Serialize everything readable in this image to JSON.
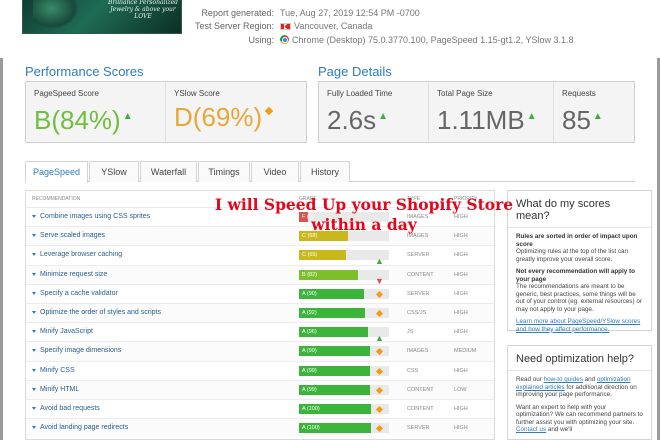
{
  "report": {
    "thumbnail_text": "Brilliance Personalized Jewelry & above your LOVE",
    "generated_label": "Report generated:",
    "generated_value": "Tue, Aug 27, 2019 12:54 PM -0700",
    "region_label": "Test Server Region:",
    "region_value": "Vancouver, Canada",
    "using_label": "Using:",
    "using_value": "Chrome (Desktop) 75.0.3770.100, PageSpeed 1.15-gt1.2, YSlow 3.1.8"
  },
  "performance": {
    "title": "Performance Scores",
    "pagespeed": {
      "label": "PageSpeed Score",
      "grade": "B",
      "value": "(84%)"
    },
    "yslow": {
      "label": "YSlow Score",
      "grade": "D",
      "value": "(69%)"
    }
  },
  "page_details": {
    "title": "Page Details",
    "load_time": {
      "label": "Fully Loaded Time",
      "value": "2.6s"
    },
    "page_size": {
      "label": "Total Page Size",
      "value": "1.11MB"
    },
    "requests": {
      "label": "Requests",
      "value": "85"
    }
  },
  "tabs": [
    "PageSpeed",
    "YSlow",
    "Waterfall",
    "Timings",
    "Video",
    "History"
  ],
  "table": {
    "headers": {
      "recommendation": "RECOMMENDATION",
      "grade": "GRADE",
      "type": "TYPE",
      "priority": "PRIORITY"
    },
    "rows": [
      {
        "name": "Combine images using CSS sprites",
        "grade": "F (0)",
        "score": 0,
        "trend": "",
        "type": "IMAGES",
        "priority": "HIGH",
        "band": "f"
      },
      {
        "name": "Serve scaled images",
        "grade": "C (68)",
        "score": 68,
        "trend": "",
        "type": "IMAGES",
        "priority": "HIGH",
        "band": "c"
      },
      {
        "name": "Leverage browser caching",
        "grade": "C (65)",
        "score": 65,
        "trend": "up",
        "type": "SERVER",
        "priority": "HIGH",
        "band": "c"
      },
      {
        "name": "Minimize request size",
        "grade": "B (82)",
        "score": 82,
        "trend": "down",
        "type": "CONTENT",
        "priority": "HIGH",
        "band": "b"
      },
      {
        "name": "Specify a cache validator",
        "grade": "A (90)",
        "score": 90,
        "trend": "neutral",
        "type": "SERVER",
        "priority": "HIGH",
        "band": "a"
      },
      {
        "name": "Optimize the order of styles and scripts",
        "grade": "A (92)",
        "score": 92,
        "trend": "neutral",
        "type": "CSS/JS",
        "priority": "HIGH",
        "band": "a"
      },
      {
        "name": "Minify JavaScript",
        "grade": "A (96)",
        "score": 96,
        "trend": "up",
        "type": "JS",
        "priority": "HIGH",
        "band": "a"
      },
      {
        "name": "Specify image dimensions",
        "grade": "A (99)",
        "score": 99,
        "trend": "neutral",
        "type": "IMAGES",
        "priority": "MEDIUM",
        "band": "a"
      },
      {
        "name": "Minify CSS",
        "grade": "A (99)",
        "score": 99,
        "trend": "neutral",
        "type": "CSS",
        "priority": "HIGH",
        "band": "a"
      },
      {
        "name": "Minify HTML",
        "grade": "A (99)",
        "score": 99,
        "trend": "neutral",
        "type": "CONTENT",
        "priority": "LOW",
        "band": "a"
      },
      {
        "name": "Avoid bad requests",
        "grade": "A (100)",
        "score": 100,
        "trend": "neutral",
        "type": "CONTENT",
        "priority": "HIGH",
        "band": "a"
      },
      {
        "name": "Avoid landing page redirects",
        "grade": "A (100)",
        "score": 100,
        "trend": "neutral",
        "type": "SERVER",
        "priority": "HIGH",
        "band": "a"
      }
    ]
  },
  "side_scores": {
    "title": "What do my scores mean?",
    "p1_bold": "Rules are sorted in order of impact upon score",
    "p1": "Optimizing rules at the top of the list can greatly improve your overall score.",
    "p2_bold": "Not every recommendation will apply to your page",
    "p2": "The recommendations are meant to be generic, best practices, some things will be out of your control (eg. external resources) or may not apply to your page.",
    "link": "Learn more about PageSpeed/YSlow scores and how they affect performance."
  },
  "side_help": {
    "title": "Need optimization help?",
    "p1_pre": "Read our",
    "p1_link1": "how-to guides",
    "p1_and": "and",
    "p1_link2": "optimization explained articles",
    "p1_post": "for additional direction on improving your page performance.",
    "p2_pre": "Want an expert to help with your optimization? We can recommend partners to further assist you with optimizing your site.",
    "p2_link": "Contact us",
    "p2_post": "and we'll"
  },
  "overlay": {
    "line1": "I will Speed Up your Shopify Store",
    "line2": "within a day"
  },
  "colors": {
    "accent": "#2f7bc0",
    "grade_a": "#3cb43c",
    "grade_b": "#7cbf2a",
    "grade_c": "#c9b81c",
    "grade_f": "#d9534f",
    "overlay": "#e4061a"
  }
}
